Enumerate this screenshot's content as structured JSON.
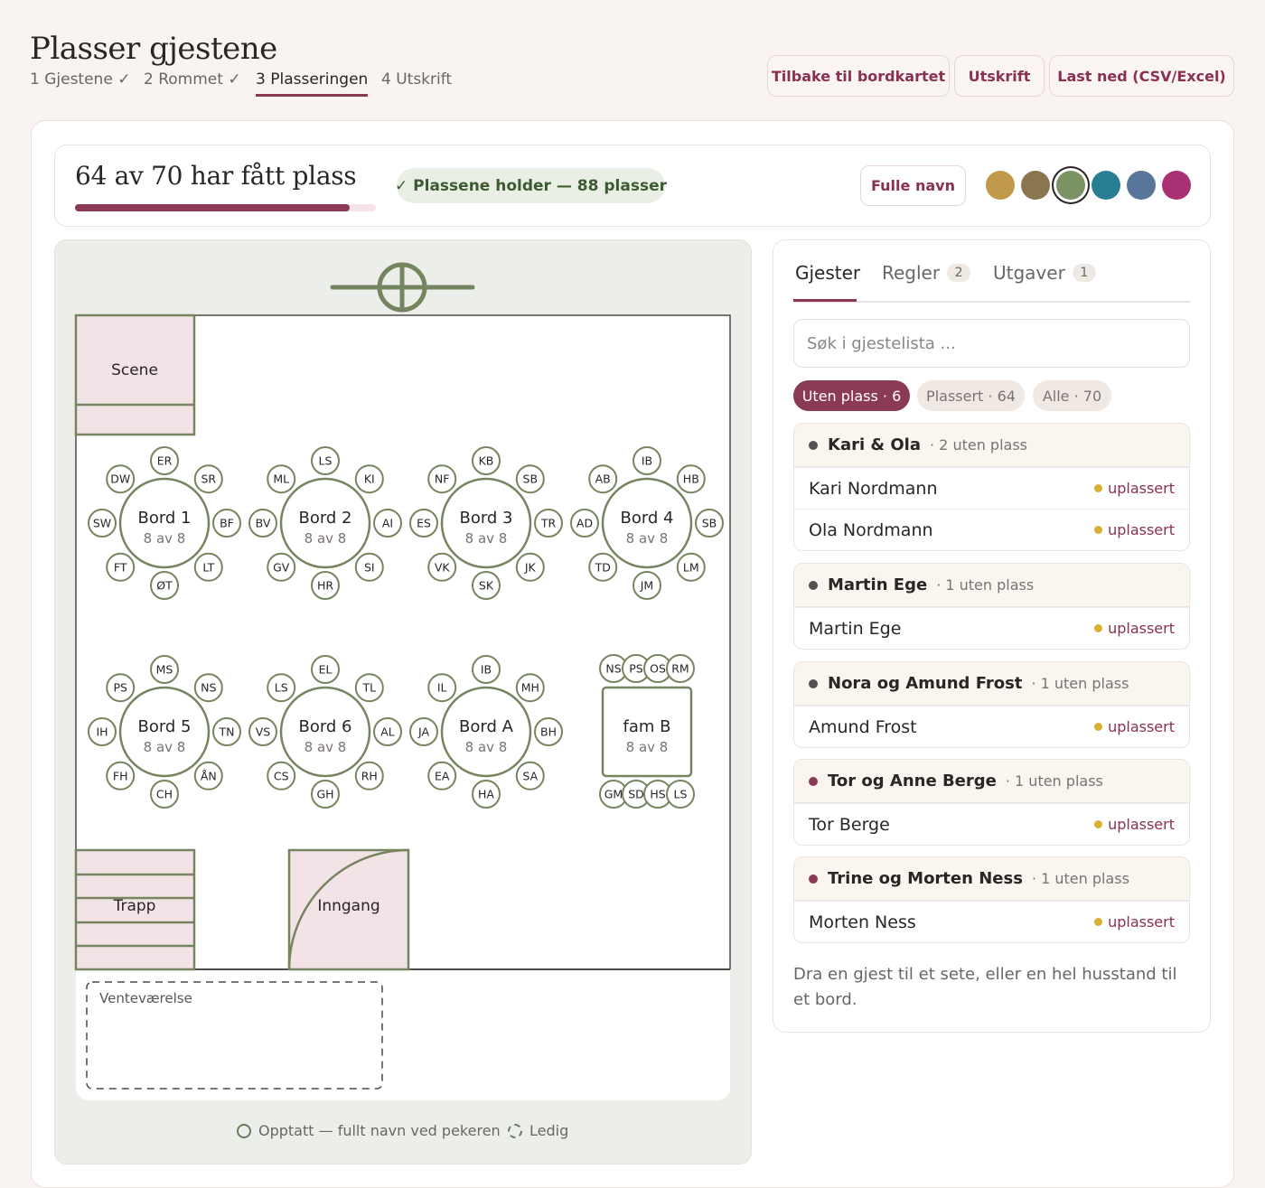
{
  "header": {
    "title": "Plasser gjestene",
    "steps": [
      "1 Gjestene ✓",
      "2 Rommet ✓",
      "3 Plasseringen",
      "4 Utskrift"
    ],
    "buttons": {
      "back": "Tilbake til bordkartet",
      "print": "Utskrift",
      "download": "Last ned (CSV/Excel)"
    }
  },
  "summary": {
    "title": "64 av 70 har fått plass",
    "progress": 0.914,
    "status": "✓ Plassene holder — 88 plasser",
    "fullnames_button": "Fulle navn",
    "colors": [
      "#c0994a",
      "#8b7550",
      "#7b9363",
      "#2a7e94",
      "#5a759a",
      "#a93073"
    ],
    "selected_color_index": 2
  },
  "map": {
    "compass_label": "",
    "rooms": {
      "stage": "Scene",
      "stairs": "Trapp",
      "entrance": "Inngang",
      "waiting": "Venteværelse"
    },
    "tables": [
      {
        "name": "Bord 1",
        "count": "8 av 8",
        "shape": "round",
        "seats": [
          "ER",
          "SR",
          "BF",
          "LT",
          "ØT",
          "FT",
          "SW",
          "DW"
        ]
      },
      {
        "name": "Bord 2",
        "count": "8 av 8",
        "shape": "round",
        "seats": [
          "LS",
          "KI",
          "AI",
          "SI",
          "HR",
          "GV",
          "BV",
          "ML"
        ]
      },
      {
        "name": "Bord 3",
        "count": "8 av 8",
        "shape": "round",
        "seats": [
          "KB",
          "SB",
          "TR",
          "JK",
          "SK",
          "VK",
          "ES",
          "NF"
        ]
      },
      {
        "name": "Bord 4",
        "count": "8 av 8",
        "shape": "round",
        "seats": [
          "IB",
          "HB",
          "SB",
          "LM",
          "JM",
          "TD",
          "AD",
          "AB"
        ]
      },
      {
        "name": "Bord 5",
        "count": "8 av 8",
        "shape": "round",
        "seats": [
          "MS",
          "NS",
          "TN",
          "ÅN",
          "CH",
          "FH",
          "IH",
          "PS"
        ]
      },
      {
        "name": "Bord 6",
        "count": "8 av 8",
        "shape": "round",
        "seats": [
          "EL",
          "TL",
          "AL",
          "RH",
          "GH",
          "CS",
          "VS",
          "LS"
        ]
      },
      {
        "name": "Bord A",
        "count": "8 av 8",
        "shape": "round",
        "seats": [
          "IB",
          "MH",
          "BH",
          "SA",
          "HA",
          "EA",
          "JA",
          "IL"
        ]
      },
      {
        "name": "fam B",
        "count": "8 av 8",
        "shape": "square",
        "seats": [
          "NS",
          "PS",
          "OS",
          "RM",
          "GM",
          "SD",
          "HS",
          "LS"
        ]
      }
    ],
    "legend": {
      "occupied": "Opptatt — fullt navn ved pekeren",
      "free": "Ledig"
    }
  },
  "panel": {
    "tabs": [
      {
        "label": "Gjester",
        "badge": ""
      },
      {
        "label": "Regler",
        "badge": "2"
      },
      {
        "label": "Utgaver",
        "badge": "1"
      }
    ],
    "search_placeholder": "Søk i gjestelista ...",
    "filters": [
      "Uten plass · 6",
      "Plassert · 64",
      "Alle · 70"
    ],
    "groups": [
      {
        "name": "Kari & Ola",
        "sub": "· 2 uten plass",
        "color": "#55504f",
        "guests": [
          {
            "name": "Kari Nordmann",
            "status": "uplassert"
          },
          {
            "name": "Ola Nordmann",
            "status": "uplassert"
          }
        ]
      },
      {
        "name": "Martin Ege",
        "sub": "· 1 uten plass",
        "color": "#55504f",
        "guests": [
          {
            "name": "Martin Ege",
            "status": "uplassert"
          }
        ]
      },
      {
        "name": "Nora og Amund Frost",
        "sub": "· 1 uten plass",
        "color": "#55504f",
        "guests": [
          {
            "name": "Amund Frost",
            "status": "uplassert"
          }
        ]
      },
      {
        "name": "Tor og Anne Berge",
        "sub": "· 1 uten plass",
        "color": "#8a3a55",
        "guests": [
          {
            "name": "Tor Berge",
            "status": "uplassert"
          }
        ]
      },
      {
        "name": "Trine og Morten Ness",
        "sub": "· 1 uten plass",
        "color": "#8a3a55",
        "guests": [
          {
            "name": "Morten Ness",
            "status": "uplassert"
          }
        ]
      }
    ],
    "hint": "Dra en gjest til et sete, eller en hel husstand til et bord."
  }
}
